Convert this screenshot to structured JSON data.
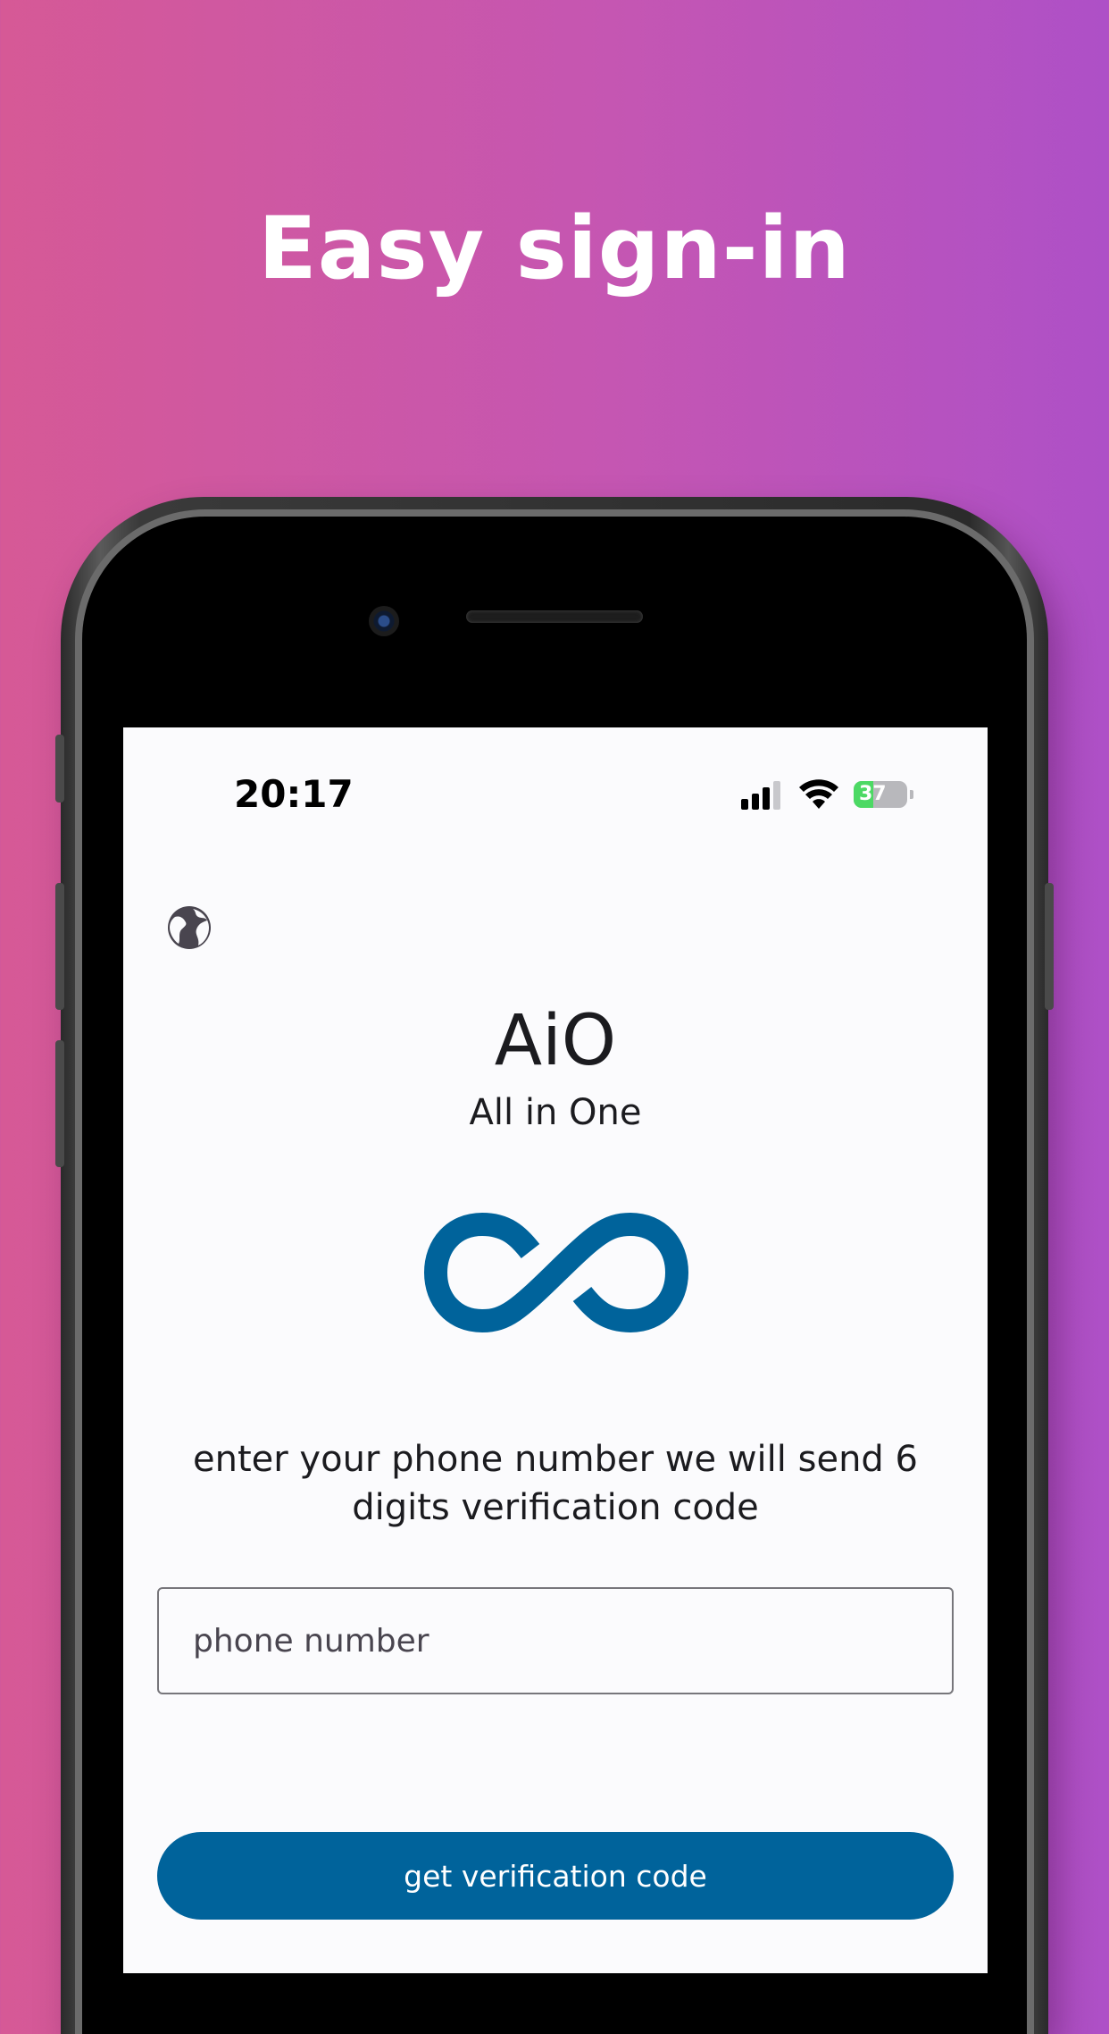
{
  "headline": "Easy sign-in",
  "status_bar": {
    "time": "20:17",
    "battery_level": "37",
    "icons": [
      "cellular-signal-icon",
      "wifi-icon",
      "battery-charging-icon"
    ]
  },
  "screen": {
    "language_icon": "globe-icon",
    "app_title": "AiO",
    "app_subtitle": "All in One",
    "logo_icon": "infinity-logo-icon",
    "instructions": "enter your phone number we will send 6 digits verification code",
    "phone_input": {
      "value": "",
      "placeholder": "phone number"
    },
    "submit_label": "get verification code"
  },
  "colors": {
    "brand_primary": "#00639b",
    "background_gradient_start": "#d65996",
    "background_gradient_end": "#ae50c7",
    "battery_charging": "#4cd964"
  }
}
